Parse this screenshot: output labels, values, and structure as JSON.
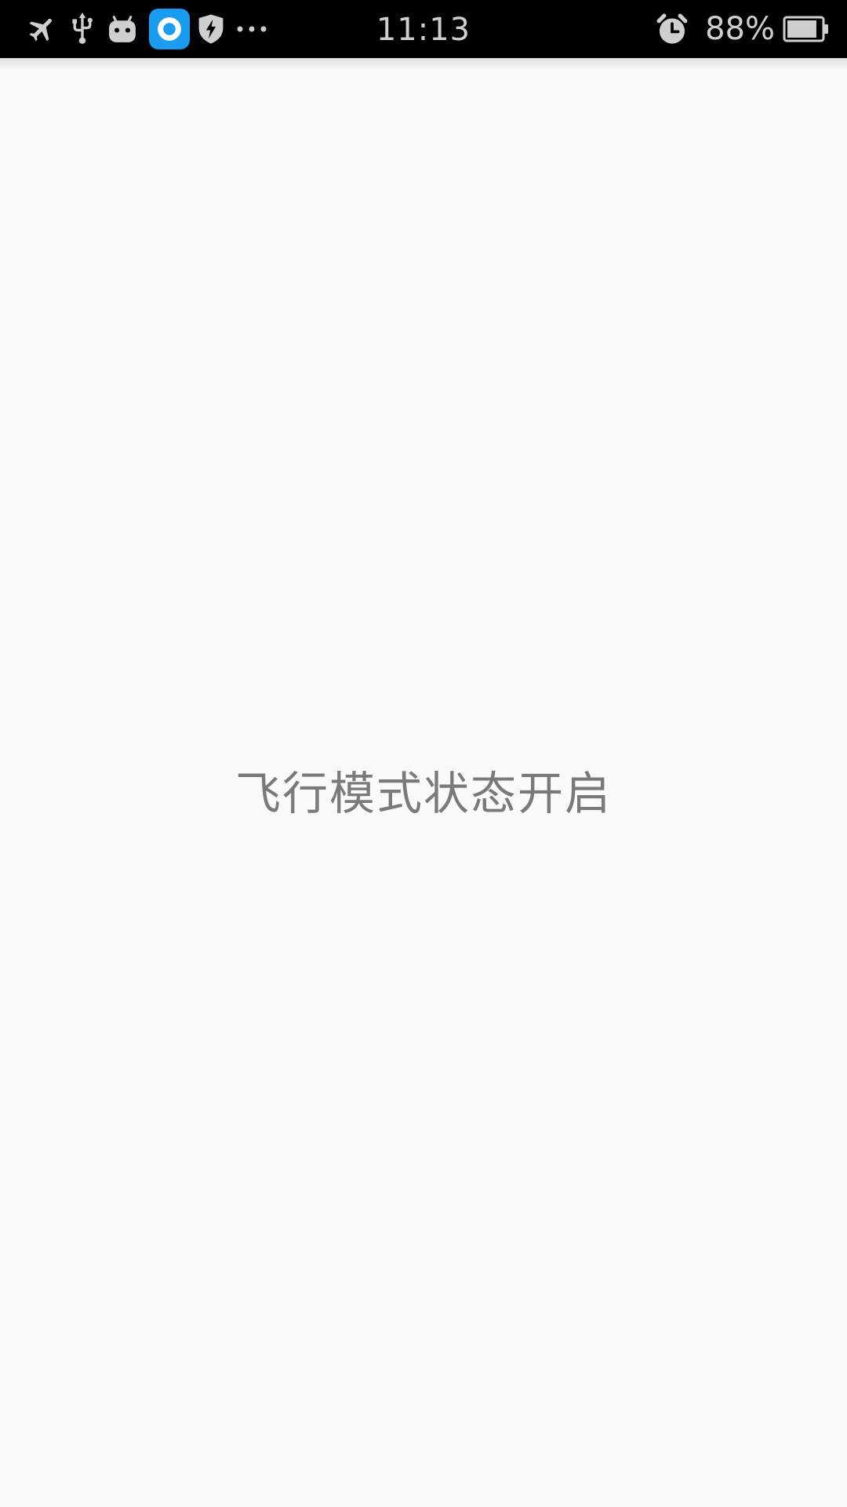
{
  "status_bar": {
    "time": "11:13",
    "battery_percent_text": "88%",
    "battery_level": 0.88,
    "left_icons": [
      "airplane-icon",
      "usb-icon",
      "android-icon",
      "app-ring-icon",
      "shield-bolt-icon",
      "more-dots-icon"
    ],
    "right_icons": [
      "alarm-icon",
      "battery-icon"
    ],
    "colors": {
      "background": "#000000",
      "icon": "#cfcfcf",
      "app_badge": "#1a9cf0"
    }
  },
  "main": {
    "message": "飞行模式状态开启",
    "colors": {
      "background": "#fafafa",
      "text": "#7a7a7a"
    }
  }
}
